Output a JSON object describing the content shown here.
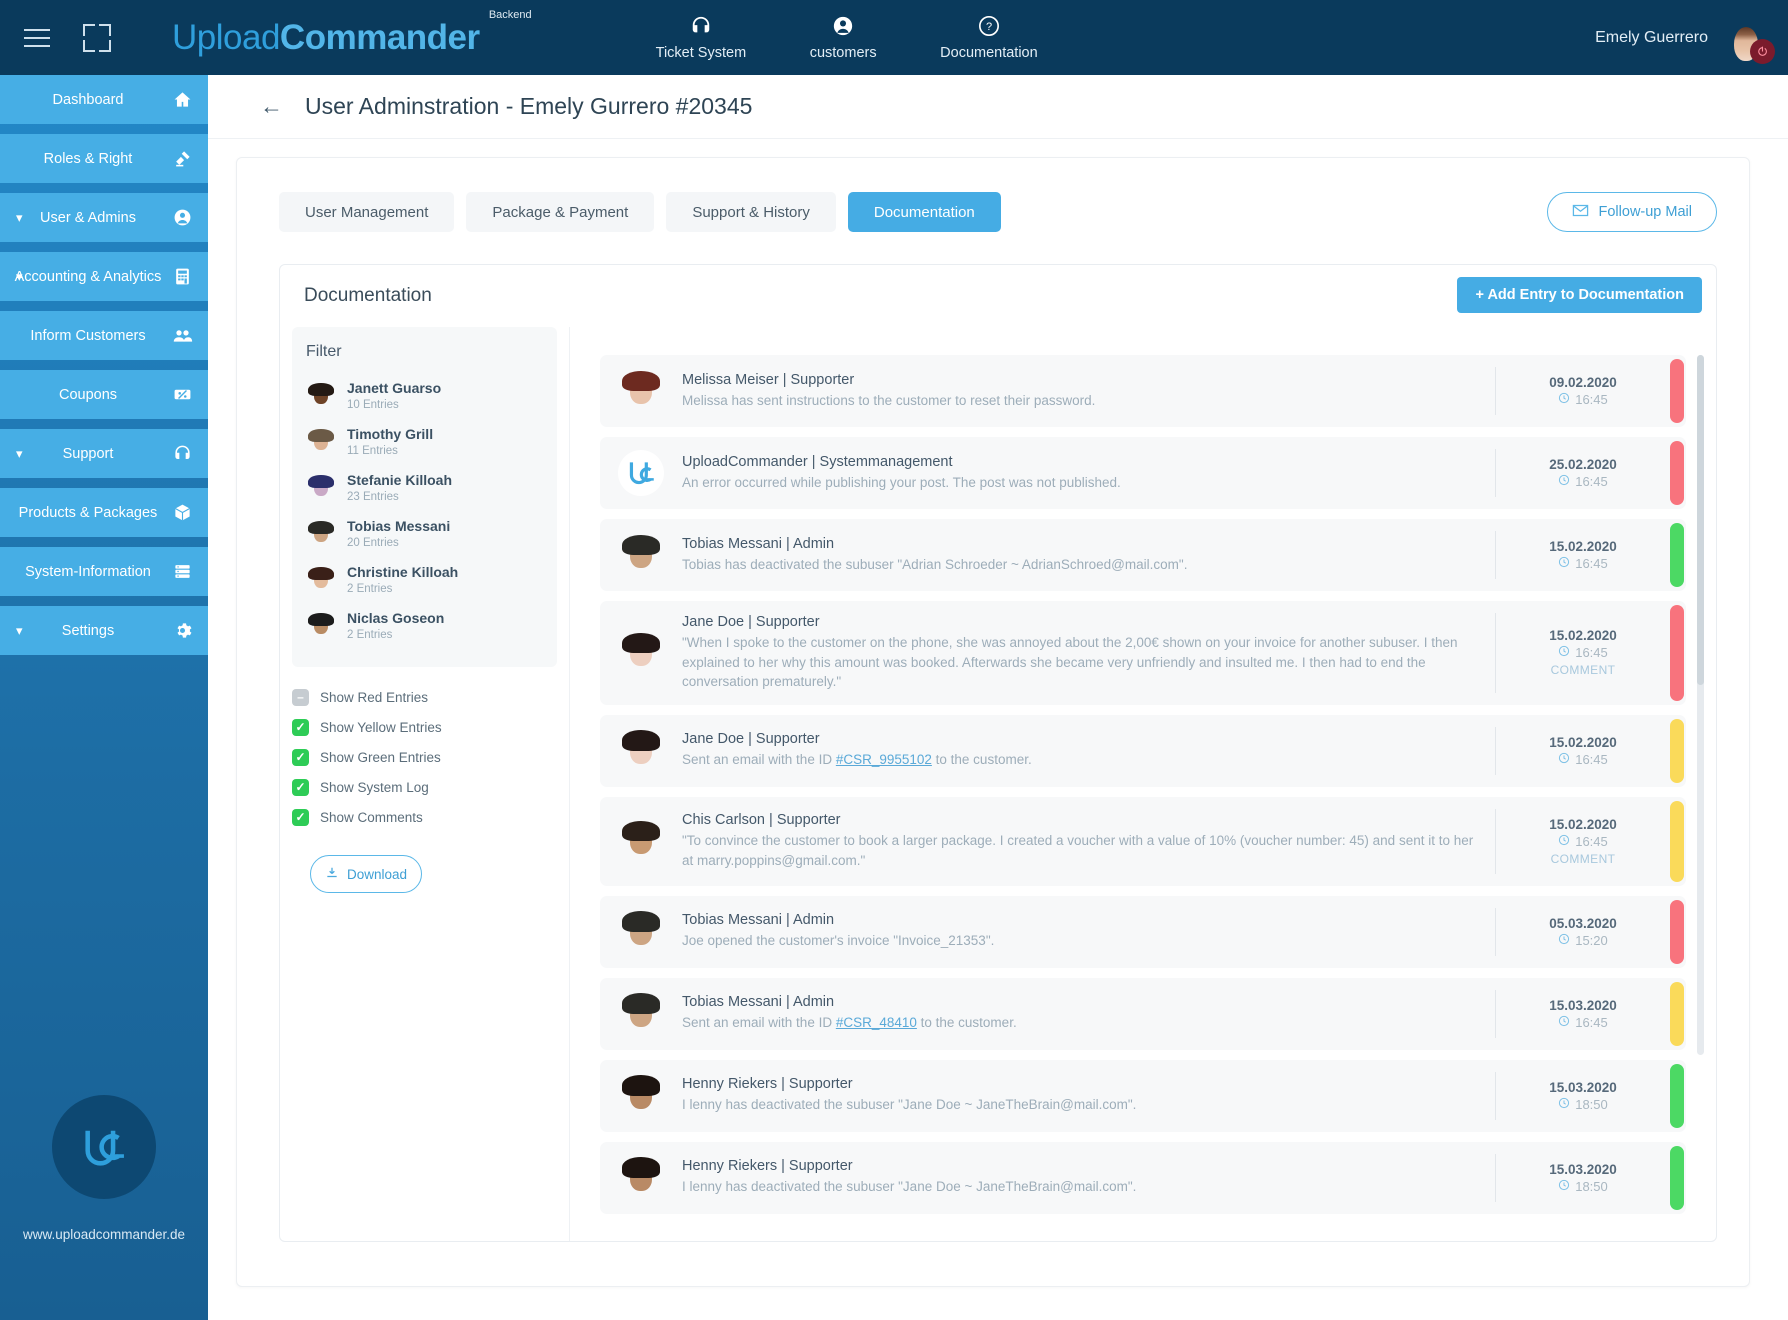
{
  "topbar": {
    "menu_icon": "hamburger-icon",
    "expand_icon": "fullscreen-icon",
    "brand_part1": "Upload",
    "brand_part2": "Commander",
    "brand_badge": "Backend",
    "nav": [
      {
        "label": "Ticket System",
        "icon": "headset-icon"
      },
      {
        "label": "customers",
        "icon": "user-circle-icon"
      },
      {
        "label": "Documentation",
        "icon": "question-circle-icon"
      }
    ],
    "user_name": "Emely Guerrero",
    "avatar_icon": "user-avatar",
    "power_icon": "power-icon"
  },
  "sidebar": {
    "items": [
      {
        "label": "Dashboard",
        "icon": "home-icon",
        "chevron": ""
      },
      {
        "label": "Roles & Right",
        "icon": "gavel-icon",
        "chevron": ""
      },
      {
        "label": "User & Admins",
        "icon": "user-circle-icon",
        "chevron": "⌄"
      },
      {
        "label": "Accounting & Analytics",
        "icon": "calculator-icon",
        "chevron": "⌄"
      },
      {
        "label": "Inform Customers",
        "icon": "people-icon",
        "chevron": ""
      },
      {
        "label": "Coupons",
        "icon": "coupon-icon",
        "chevron": ""
      },
      {
        "label": "Support",
        "icon": "headset-icon",
        "chevron": "⌄"
      },
      {
        "label": "Products & Packages",
        "icon": "box-icon",
        "chevron": ""
      },
      {
        "label": "System-Information",
        "icon": "server-icon",
        "chevron": ""
      },
      {
        "label": "Settings",
        "icon": "gear-icon",
        "chevron": "⌄"
      }
    ],
    "footer_url": "www.uploadcommander.de",
    "footer_logo": "uc-logo-icon"
  },
  "page": {
    "back_icon": "arrow-left-icon",
    "title": "User Adminstration - Emely Gurrero #20345"
  },
  "tabs": [
    {
      "label": "User Management",
      "active": false
    },
    {
      "label": "Package & Payment",
      "active": false
    },
    {
      "label": "Support & History",
      "active": false
    },
    {
      "label": "Documentation",
      "active": true
    }
  ],
  "followup": {
    "label": "Follow-up Mail",
    "icon": "envelope-icon"
  },
  "doc_panel": {
    "title": "Documentation",
    "add_button": "+ Add Entry to Documentation"
  },
  "filter": {
    "title": "Filter",
    "users": [
      {
        "name": "Janett Guarso",
        "entries": "10 Entries",
        "hair": "#241a14",
        "skin": "#6e4327"
      },
      {
        "name": "Timothy Grill",
        "entries": "11 Entries",
        "hair": "#6b5a46",
        "skin": "#ddb394"
      },
      {
        "name": "Stefanie Killoah",
        "entries": "23 Entries",
        "hair": "#2b2f6b",
        "skin": "#c9a9c6"
      },
      {
        "name": "Tobias Messani",
        "entries": "20 Entries",
        "hair": "#2a2a26",
        "skin": "#cda583"
      },
      {
        "name": "Christine Killoah",
        "entries": "2 Entries",
        "hair": "#3a2018",
        "skin": "#e3bb9c"
      },
      {
        "name": "Niclas Goseon",
        "entries": "2 Entries",
        "hair": "#1c1c1c",
        "skin": "#b98c64"
      }
    ],
    "checkboxes": [
      {
        "label": "Show Red Entries",
        "checked": false,
        "mark": "–"
      },
      {
        "label": "Show Yellow Entries",
        "checked": true,
        "mark": "✓"
      },
      {
        "label": "Show Green Entries",
        "checked": true,
        "mark": "✓"
      },
      {
        "label": "Show System Log",
        "checked": true,
        "mark": "✓"
      },
      {
        "label": "Show Comments",
        "checked": true,
        "mark": "✓"
      }
    ],
    "download_label": "Download",
    "download_icon": "download-icon"
  },
  "entries": [
    {
      "author": "Melissa Meiser | Supporter",
      "message": "Melissa has sent instructions to the customer to reset their password.",
      "date": "09.02.2020",
      "time": "16:45",
      "comment": "",
      "color": "#f8737d",
      "avatar_type": "photo",
      "hair": "#6d2a20",
      "skin": "#e8c3ab"
    },
    {
      "author": "UploadCommander | Systemmanagement",
      "message": "An error occurred while publishing your post. The post was not published.",
      "date": "25.02.2020",
      "time": "16:45",
      "comment": "",
      "color": "#f8737d",
      "avatar_type": "logo",
      "hair": "",
      "skin": ""
    },
    {
      "author": "Tobias Messani | Admin",
      "message": "Tobias has deactivated the subuser \"Adrian Schroeder ~ AdrianSchroed@mail.com\".",
      "date": "15.02.2020",
      "time": "16:45",
      "comment": "",
      "color": "#4cd964",
      "avatar_type": "photo",
      "hair": "#2a2a26",
      "skin": "#cda583"
    },
    {
      "author": "Jane Doe | Supporter",
      "message": "\"When I spoke to the customer on the phone, she was annoyed about the 2,00€ shown on your invoice for another subuser. I then explained to her why this amount was booked. Afterwards she became very unfriendly and insulted me. I then had to end the conversation prematurely.\"",
      "date": "15.02.2020",
      "time": "16:45",
      "comment": "COMMENT",
      "color": "#f8737d",
      "avatar_type": "photo",
      "hair": "#231816",
      "skin": "#edcfc0"
    },
    {
      "author": "Jane Doe | Supporter",
      "message_pre": "Sent an email with the ID ",
      "message_link": "#CSR_9955102",
      "message_post": " to the customer.",
      "date": "15.02.2020",
      "time": "16:45",
      "comment": "",
      "color": "#fada5a",
      "avatar_type": "photo",
      "hair": "#231816",
      "skin": "#edcfc0"
    },
    {
      "author": "Chis Carlson | Supporter",
      "message": "\"To convince the customer to book a larger package. I created a voucher with a value of 10% (voucher number: 45) and sent it to her at marry.poppins@gmail.com.\"",
      "date": "15.02.2020",
      "time": "16:45",
      "comment": "COMMENT",
      "color": "#fada5a",
      "avatar_type": "photo",
      "hair": "#2b2019",
      "skin": "#c89a72"
    },
    {
      "author": "Tobias Messani | Admin",
      "message": "Joe opened the customer's invoice \"Invoice_21353\".",
      "date": "05.03.2020",
      "time": "15:20",
      "comment": "",
      "color": "#f8737d",
      "avatar_type": "photo",
      "hair": "#2a2a26",
      "skin": "#cda583"
    },
    {
      "author": "Tobias Messani | Admin",
      "message_pre": "Sent an email with the ID ",
      "message_link": "#CSR_48410",
      "message_post": " to the customer.",
      "date": "15.03.2020",
      "time": "16:45",
      "comment": "",
      "color": "#fada5a",
      "avatar_type": "photo",
      "hair": "#2a2a26",
      "skin": "#cda583"
    },
    {
      "author": "Henny Riekers | Supporter",
      "message": "I lenny has deactivated the subuser \"Jane Doe ~ JaneTheBrain@mail.com\".",
      "date": "15.03.2020",
      "time": "18:50",
      "comment": "",
      "color": "#4cd964",
      "avatar_type": "photo",
      "hair": "#1d1410",
      "skin": "#b98a65"
    },
    {
      "author": "Henny Riekers | Supporter",
      "message": "I lenny has deactivated the subuser \"Jane Doe ~ JaneTheBrain@mail.com\".",
      "date": "15.03.2020",
      "time": "18:50",
      "comment": "",
      "color": "#4cd964",
      "avatar_type": "photo",
      "hair": "#1d1410",
      "skin": "#b98a65"
    }
  ],
  "colors": {
    "topbar_bg": "#0a3a5c",
    "sidebar_item": "#46aee5",
    "accent": "#45ace4",
    "red": "#f8737d",
    "yellow": "#fada5a",
    "green": "#4cd964"
  }
}
